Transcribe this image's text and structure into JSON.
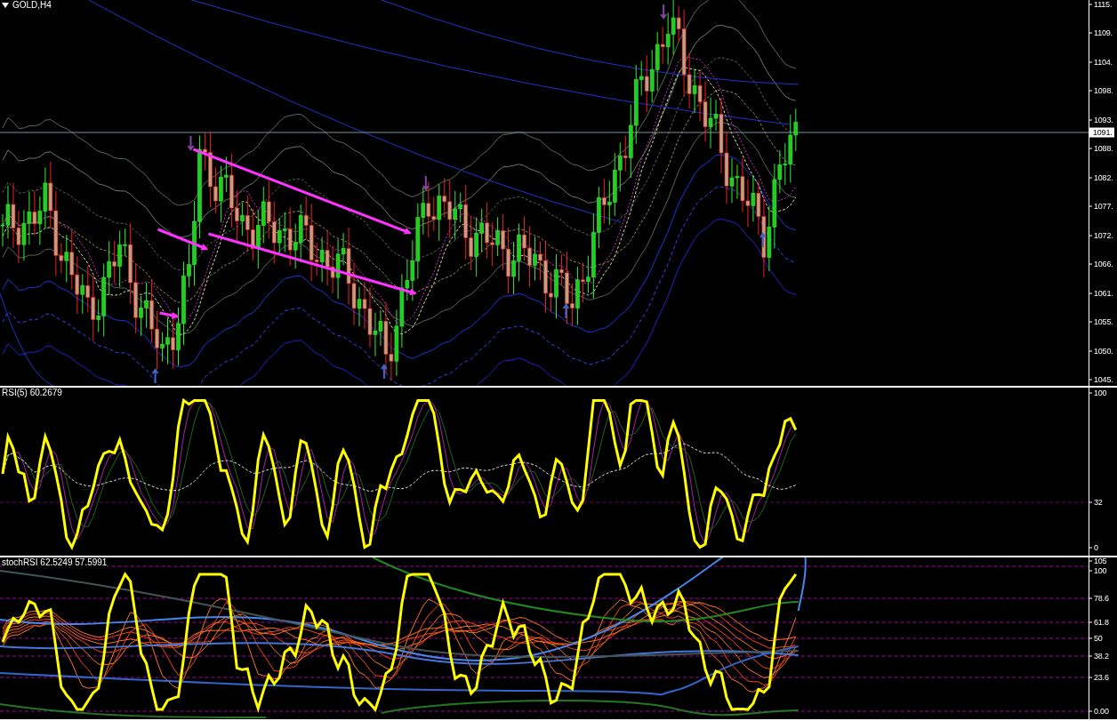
{
  "chart": {
    "title": "GOLD,H4",
    "price_axis": [
      "1115.",
      "1109.",
      "1104.",
      "1098.",
      "1093.",
      "1088.",
      "1082.",
      "1077.",
      "1072.",
      "1066.",
      "1061.",
      "1055.",
      "1050.",
      "1045."
    ],
    "current_price": "1091."
  },
  "rsi": {
    "title": "RSI(5) 60.2679",
    "axis": [
      "100",
      "32",
      "0"
    ]
  },
  "stoch_rsi": {
    "title": "stochRSI 62.5249 57.5991",
    "axis": [
      "105",
      "100",
      "78.6",
      "61.8",
      "50",
      "38.2",
      "23.6",
      "0.00"
    ]
  }
}
